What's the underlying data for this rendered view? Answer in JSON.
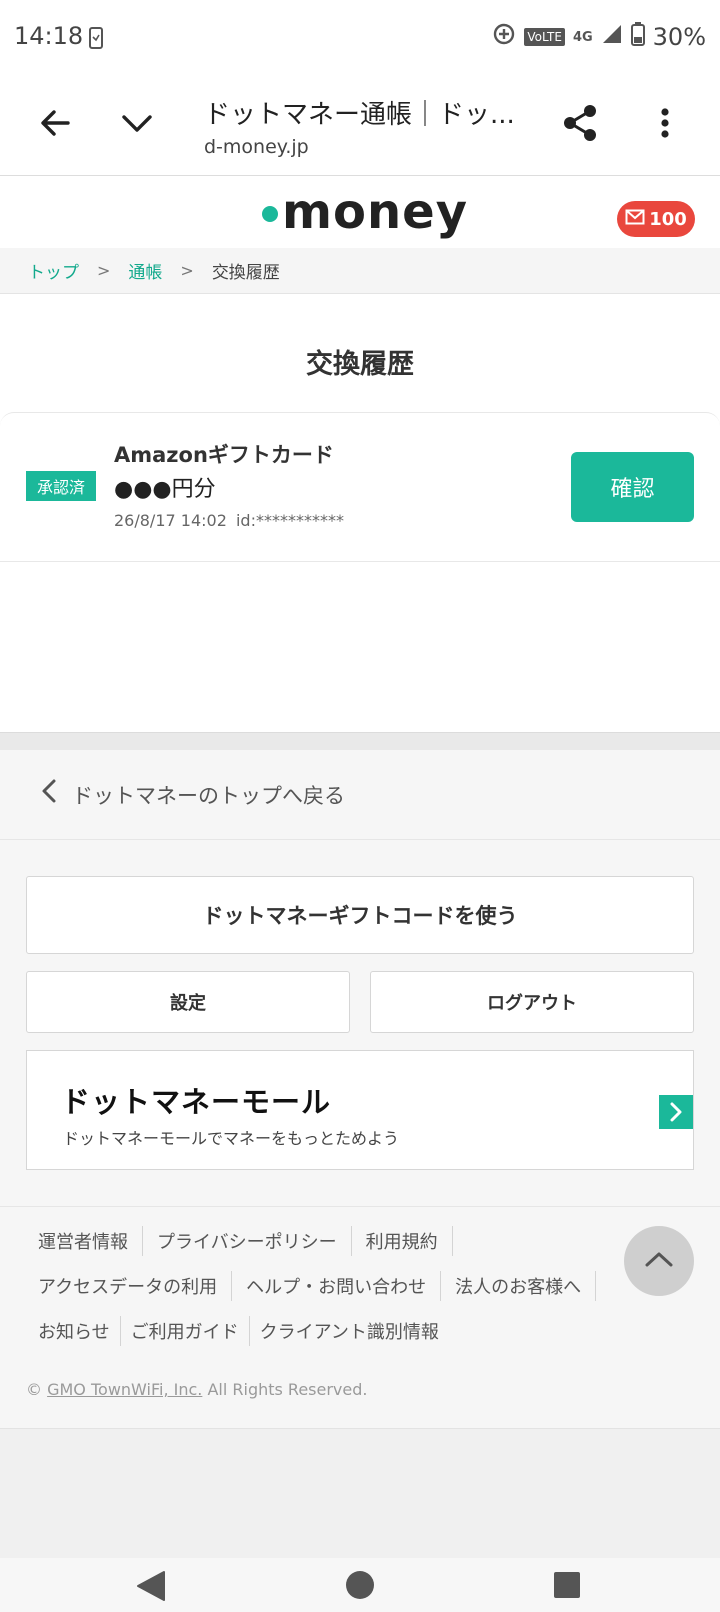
{
  "status_bar": {
    "time": "14:18",
    "network": "4G",
    "volte": "VoLTE",
    "battery": "30%"
  },
  "browser": {
    "title": "ドットマネー通帳｜ドッ...",
    "url": "d-money.jp"
  },
  "site": {
    "logo_text": "money",
    "mail_count": "100"
  },
  "breadcrumb": {
    "items": [
      "トップ",
      "通帳"
    ],
    "current": "交換履歴"
  },
  "page": {
    "title": "交換履歴"
  },
  "history": [
    {
      "status": "承認済",
      "name": "Amazonギフトカード",
      "amount": "●●●円分",
      "datetime": "26/8/17 14:02",
      "id_label": "id:",
      "id_value": "***********",
      "action": "確認"
    }
  ],
  "footer_nav": {
    "back_label": "ドットマネーのトップへ戻る",
    "gift_code_button": "ドットマネーギフトコードを使う",
    "settings_button": "設定",
    "logout_button": "ログアウト",
    "mall_title": "ドットマネーモール",
    "mall_subtitle": "ドットマネーモールでマネーをもっとためよう"
  },
  "footer_links": {
    "row1": [
      "運営者情報",
      "プライバシーポリシー",
      "利用規約"
    ],
    "row2": [
      "アクセスデータの利用",
      "ヘルプ・お問い合わせ",
      "法人のお客様へ"
    ],
    "row3": [
      "お知らせ",
      "ご利用ガイド",
      "クライアント識別情報"
    ]
  },
  "copyright": {
    "symbol": "©",
    "company": "GMO TownWiFi, Inc.",
    "rest": "All Rights Reserved."
  },
  "colors": {
    "accent": "#1bb89a",
    "badge_red": "#e9473d"
  }
}
